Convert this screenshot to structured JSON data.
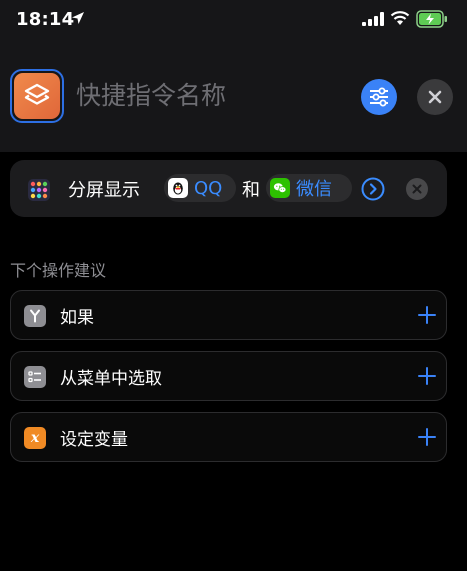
{
  "status_bar": {
    "time": "18:14"
  },
  "header": {
    "title_placeholder": "快捷指令名称"
  },
  "action": {
    "text": "分屏显示",
    "app1": "QQ",
    "conjunction": "和",
    "app2": "微信"
  },
  "suggestions": {
    "title": "下个操作建议",
    "items": [
      {
        "label": "如果",
        "icon": "branch-icon",
        "color": "#8e8e93"
      },
      {
        "label": "从菜单中选取",
        "icon": "list-icon",
        "color": "#8e8e93"
      },
      {
        "label": "设定变量",
        "icon": "variable-icon",
        "color": "#f08a24"
      }
    ]
  },
  "colors": {
    "accent": "#3a82f7",
    "shortcut_icon": "#e9723f"
  }
}
